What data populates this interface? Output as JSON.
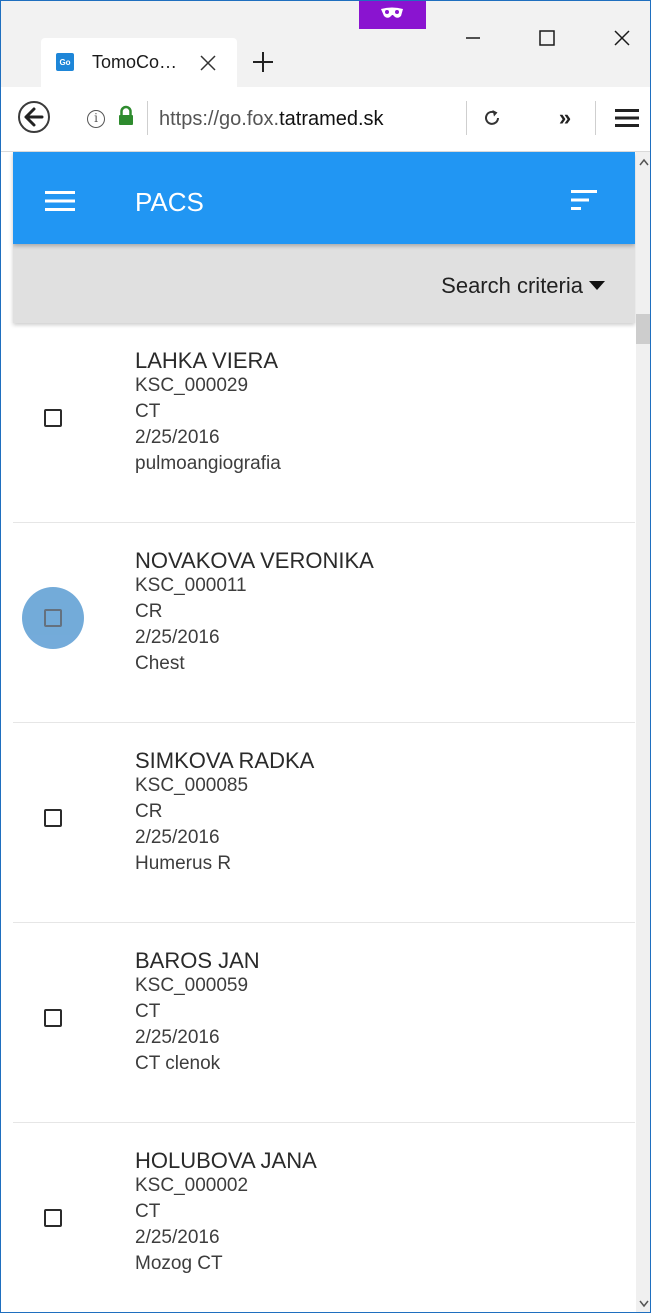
{
  "browser": {
    "tab_title": "TomoCo…",
    "tab_favicon_text": "Go",
    "url_prefix": "https://go.fox.",
    "url_domain": "tatramed.sk",
    "info_glyph": "i",
    "overflow_glyph": "»"
  },
  "app": {
    "title": "PACS",
    "search_label": "Search criteria",
    "accent_color": "#2196f3"
  },
  "studies": [
    {
      "name": "LAHKA VIERA",
      "id": "KSC_000029",
      "modality": "CT",
      "date": "2/25/2016",
      "description": "pulmoangiografia",
      "checked": false,
      "focused": false
    },
    {
      "name": "NOVAKOVA VERONIKA",
      "id": "KSC_000011",
      "modality": "CR",
      "date": "2/25/2016",
      "description": "Chest",
      "checked": false,
      "focused": true
    },
    {
      "name": "SIMKOVA RADKA",
      "id": "KSC_000085",
      "modality": "CR",
      "date": "2/25/2016",
      "description": "Humerus R",
      "checked": false,
      "focused": false
    },
    {
      "name": "BAROS JAN",
      "id": "KSC_000059",
      "modality": "CT",
      "date": "2/25/2016",
      "description": "CT clenok",
      "checked": false,
      "focused": false
    },
    {
      "name": "HOLUBOVA JANA",
      "id": "KSC_000002",
      "modality": "CT",
      "date": "2/25/2016",
      "description": "Mozog CT",
      "checked": false,
      "focused": false
    }
  ]
}
